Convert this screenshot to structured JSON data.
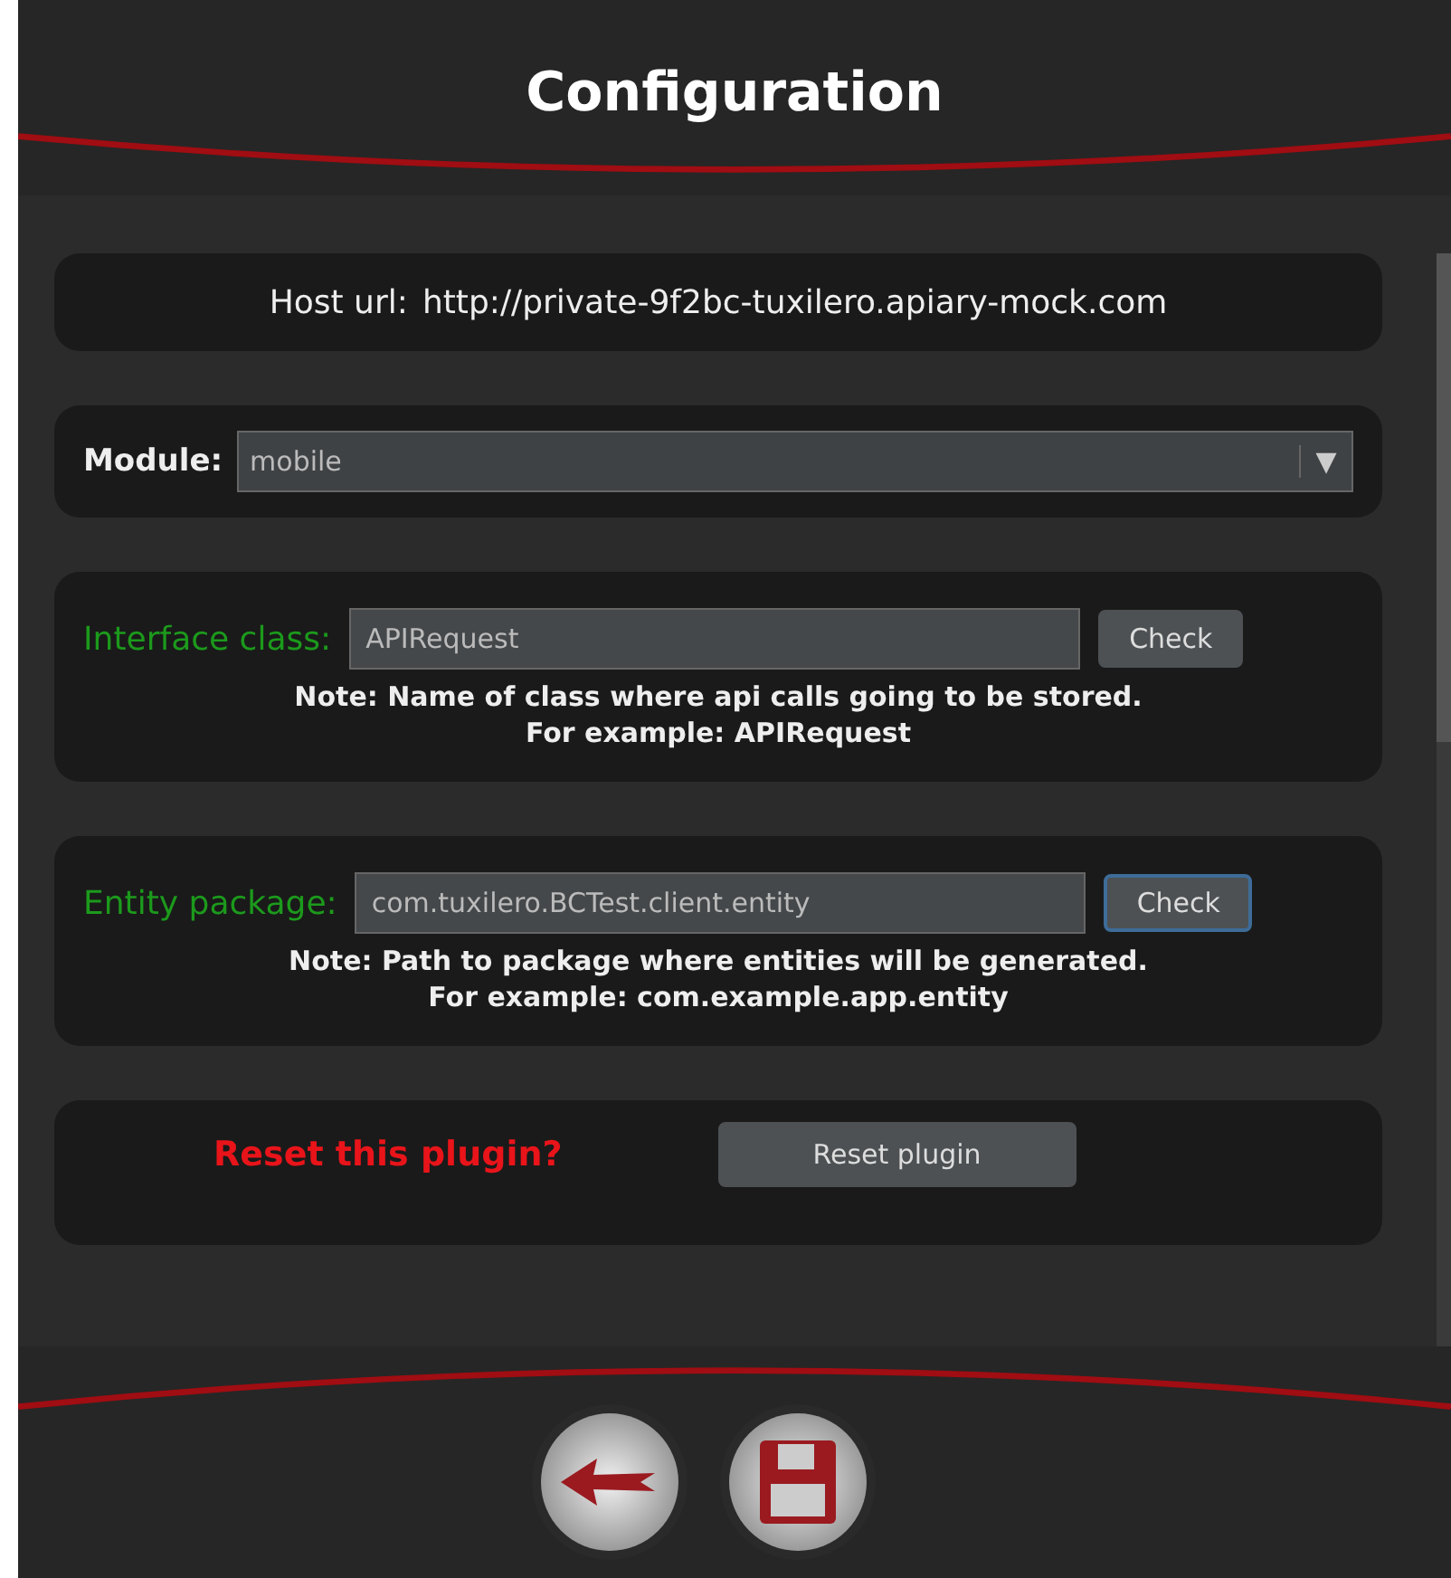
{
  "header": {
    "title": "Configuration"
  },
  "host": {
    "label": "Host url:",
    "value": "http://private-9f2bc-tuxilero.apiary-mock.com"
  },
  "module": {
    "label": "Module:",
    "value": "mobile",
    "arrow": "▼"
  },
  "fields": [
    {
      "label": "Interface class:",
      "value": "APIRequest",
      "button": "Check",
      "focused": false,
      "note": "Note: Name of class where api calls going to be stored.",
      "example": "For example: APIRequest"
    },
    {
      "label": "Entity package:",
      "value": "com.tuxilero.BCTest.client.entity",
      "button": "Check",
      "focused": true,
      "note": "Note: Path to package where entities will be generated.",
      "example": "For example: com.example.app.entity"
    }
  ],
  "reset": {
    "label": "Reset this plugin?",
    "button": "Reset plugin"
  },
  "footer": {
    "buttons": [
      {
        "kind": "back"
      },
      {
        "kind": "save"
      }
    ]
  }
}
